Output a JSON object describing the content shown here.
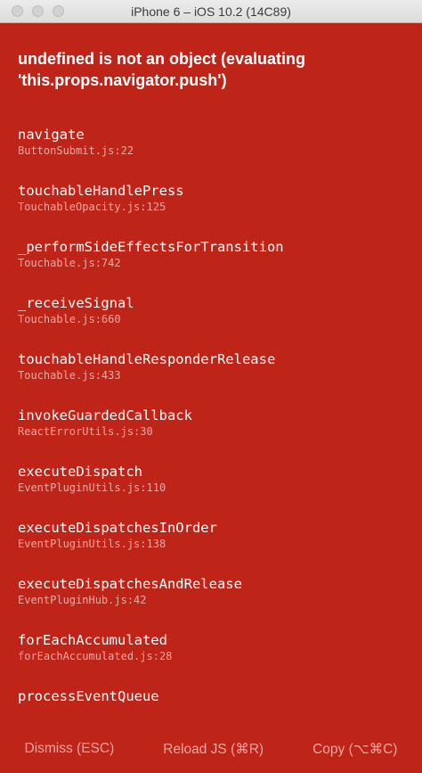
{
  "window": {
    "title": "iPhone 6 – iOS 10.2 (14C89)"
  },
  "error": {
    "message": "undefined is not an object (evaluating 'this.props.navigator.push')"
  },
  "stack": [
    {
      "method": "navigate",
      "location": "ButtonSubmit.js:22"
    },
    {
      "method": "touchableHandlePress",
      "location": "TouchableOpacity.js:125"
    },
    {
      "method": "_performSideEffectsForTransition",
      "location": "Touchable.js:742"
    },
    {
      "method": "_receiveSignal",
      "location": "Touchable.js:660"
    },
    {
      "method": "touchableHandleResponderRelease",
      "location": "Touchable.js:433"
    },
    {
      "method": "invokeGuardedCallback",
      "location": "ReactErrorUtils.js:30"
    },
    {
      "method": "executeDispatch",
      "location": "EventPluginUtils.js:110"
    },
    {
      "method": "executeDispatchesInOrder",
      "location": "EventPluginUtils.js:138"
    },
    {
      "method": "executeDispatchesAndRelease",
      "location": "EventPluginHub.js:42"
    },
    {
      "method": "forEachAccumulated",
      "location": "forEachAccumulated.js:28"
    },
    {
      "method": "processEventQueue",
      "location": ""
    }
  ],
  "buttons": {
    "dismiss": "Dismiss (ESC)",
    "reload": "Reload JS (⌘R)",
    "copy": "Copy (⌥⌘C)"
  },
  "colors": {
    "background": "#bf2419",
    "text": "#ffffff",
    "secondary_text": "#f0a9a4"
  }
}
